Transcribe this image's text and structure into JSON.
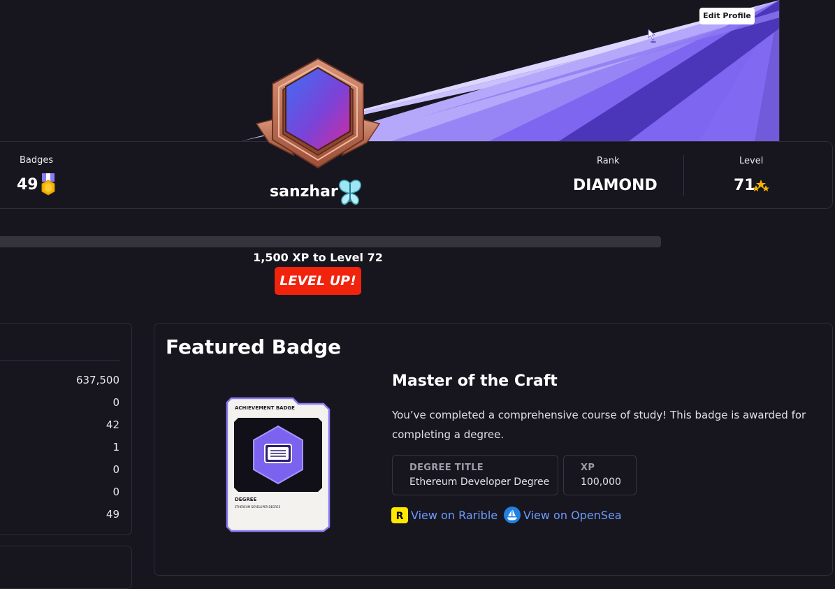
{
  "header": {
    "edit_profile_label": "Edit Profile"
  },
  "stats": {
    "badges": {
      "label": "Badges",
      "value": "49"
    },
    "username": "sanzhar",
    "rank": {
      "label": "Rank",
      "value": "DIAMOND"
    },
    "level": {
      "label": "Level",
      "value": "71"
    }
  },
  "progress": {
    "text": "1,500 XP to Level 72",
    "level_up_label": "LEVEL UP!"
  },
  "left_stats": {
    "values": [
      "637,500",
      "0",
      "42",
      "1",
      "0",
      "0",
      "49"
    ]
  },
  "featured": {
    "title": "Featured Badge",
    "badge_name": "Master of the Craft",
    "description": "You’ve completed a comprehensive course of study! This badge is awarded for completing a degree.",
    "degree_title_label": "DEGREE TITLE",
    "degree_title_value": "Ethereum Developer Degree",
    "xp_label": "XP",
    "xp_value": "100,000",
    "rarible_label": "View on Rarible",
    "opensea_label": "View on OpenSea",
    "card": {
      "header": "ACHIEVEMENT BADGE",
      "type": "DEGREE",
      "subtitle": "ETHEREUM DEVELOPER DEGREE"
    }
  },
  "colors": {
    "background": "#17161f",
    "accent_purple": "#7b63f0",
    "level_up_red": "#f2230c",
    "link_blue": "#6d9bff",
    "bronze": "#c0765a"
  }
}
